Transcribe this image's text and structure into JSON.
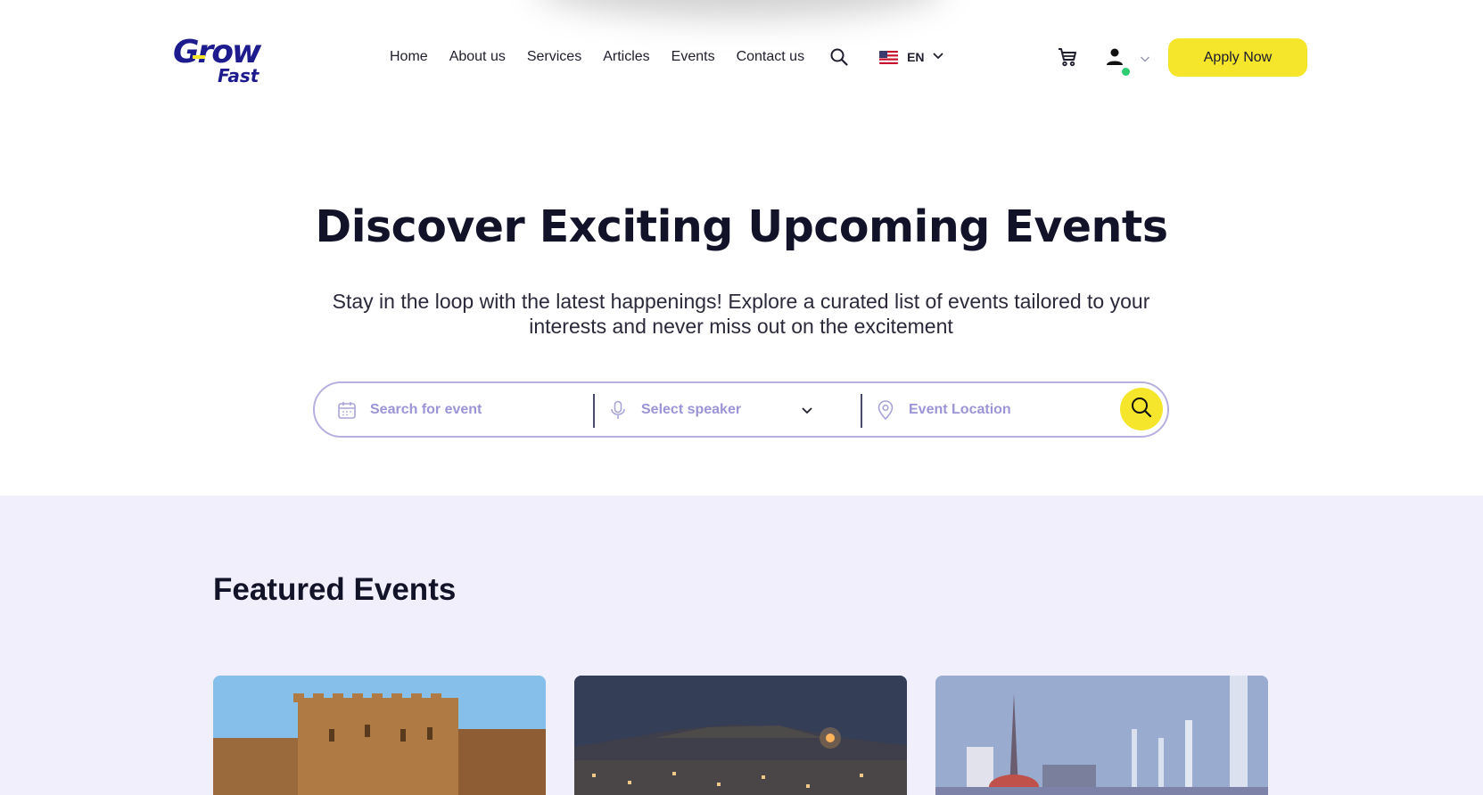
{
  "brand": {
    "logo_text_top": "Grow",
    "logo_text_bottom": "Fast",
    "color_primary": "#1e1b8f",
    "color_accent": "#f5e62b"
  },
  "nav": {
    "items": [
      "Home",
      "About us",
      "Services",
      "Articles",
      "Events",
      "Contact us"
    ],
    "language": "EN",
    "icons": {
      "search": "search-icon",
      "cart": "cart-icon",
      "user": "user-icon"
    }
  },
  "header": {
    "apply_label": "Apply Now"
  },
  "hero": {
    "title": "Discover Exciting Upcoming Events",
    "subtitle": "Stay in the loop with the latest happenings! Explore a curated list of events tailored to your interests and never miss out on the excitement"
  },
  "search": {
    "event_placeholder": "Search for event",
    "speaker_placeholder": "Select speaker",
    "location_placeholder": "Event Location",
    "event_value": "",
    "location_value": ""
  },
  "featured": {
    "title": "Featured Events",
    "cards": [
      {
        "image": "citadel-photo"
      },
      {
        "image": "night-city-photo"
      },
      {
        "image": "fountain-monument-photo"
      }
    ]
  }
}
